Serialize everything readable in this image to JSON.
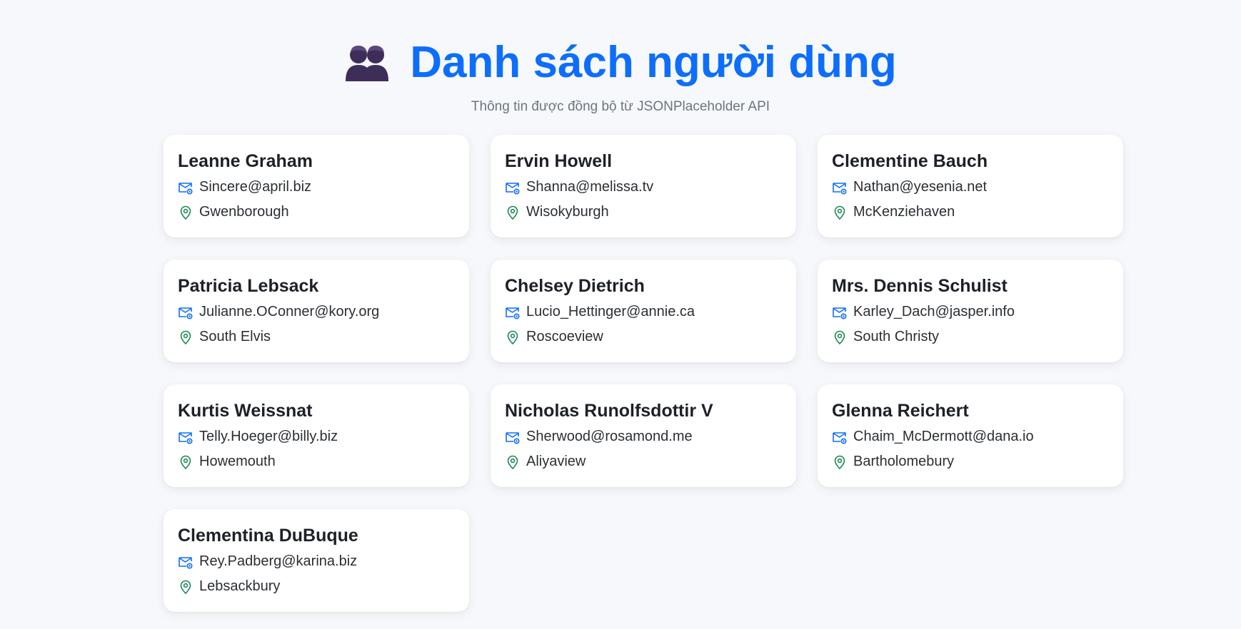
{
  "header": {
    "title": "Danh sách người dùng",
    "subtitle": "Thông tin được đồng bộ từ JSONPlaceholder API",
    "icon": "users-icon"
  },
  "colors": {
    "background": "#f7f8fb",
    "title": "#0d6efd",
    "email_icon": "#0d6efd",
    "location_icon": "#198754",
    "card": "#ffffff"
  },
  "users": [
    {
      "name": "Leanne Graham",
      "email": "Sincere@april.biz",
      "city": "Gwenborough"
    },
    {
      "name": "Ervin Howell",
      "email": "Shanna@melissa.tv",
      "city": "Wisokyburgh"
    },
    {
      "name": "Clementine Bauch",
      "email": "Nathan@yesenia.net",
      "city": "McKenziehaven"
    },
    {
      "name": "Patricia Lebsack",
      "email": "Julianne.OConner@kory.org",
      "city": "South Elvis"
    },
    {
      "name": "Chelsey Dietrich",
      "email": "Lucio_Hettinger@annie.ca",
      "city": "Roscoeview"
    },
    {
      "name": "Mrs. Dennis Schulist",
      "email": "Karley_Dach@jasper.info",
      "city": "South Christy"
    },
    {
      "name": "Kurtis Weissnat",
      "email": "Telly.Hoeger@billy.biz",
      "city": "Howemouth"
    },
    {
      "name": "Nicholas Runolfsdottir V",
      "email": "Sherwood@rosamond.me",
      "city": "Aliyaview"
    },
    {
      "name": "Glenna Reichert",
      "email": "Chaim_McDermott@dana.io",
      "city": "Bartholomebury"
    },
    {
      "name": "Clementina DuBuque",
      "email": "Rey.Padberg@karina.biz",
      "city": "Lebsackbury"
    }
  ]
}
